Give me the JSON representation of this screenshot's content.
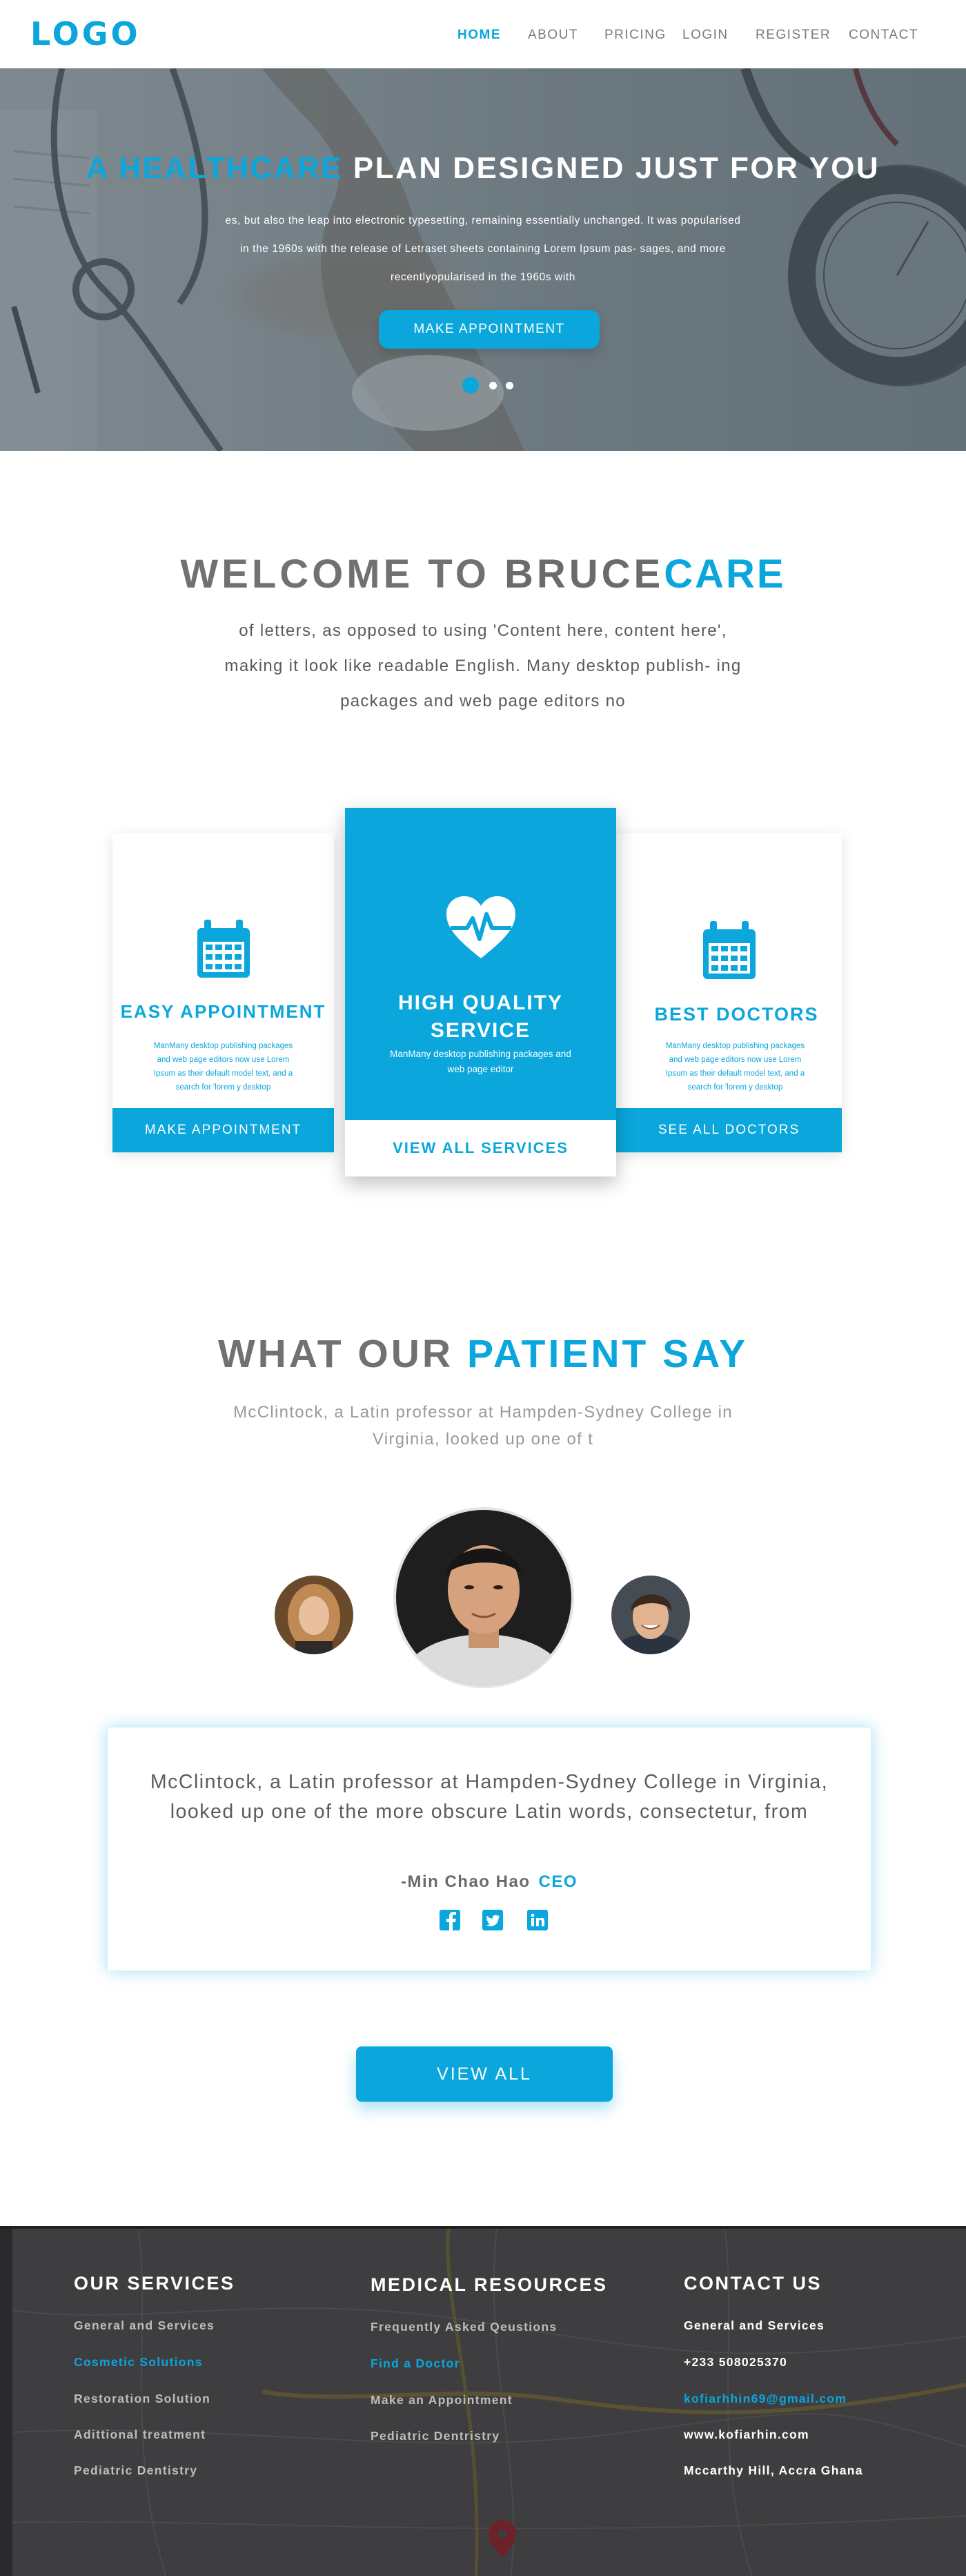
{
  "brand": {
    "logo": "LOGO",
    "accent": "#0aa6dc"
  },
  "nav": {
    "items": [
      {
        "label": "HOME",
        "active": true
      },
      {
        "label": "ABOUT",
        "active": false
      },
      {
        "label": "PRICING",
        "active": false
      },
      {
        "label": "LOGIN",
        "active": false
      },
      {
        "label": "REGISTER",
        "active": false
      },
      {
        "label": "CONTACT",
        "active": false
      }
    ]
  },
  "hero": {
    "title_highlight": "A HEALTHCARE",
    "title_rest": " PLAN DESIGNED JUST FOR YOU",
    "text": "es, but also the leap into electronic typesetting, remaining essentially unchanged. It was popularised in the 1960s with the release of Letraset sheets containing Lorem Ipsum pas- sages, and more recentlyopularised in the 1960s with",
    "button": "MAKE APPOINTMENT",
    "slides": 3,
    "active_slide": 1
  },
  "welcome": {
    "prefix": "WELCOME TO ",
    "brand_a": "BRUCE",
    "brand_b": "CARE",
    "text": "of letters, as opposed to using 'Content here, content here', making it look like readable English. Many desktop publish- ing packages and web page editors no"
  },
  "services": [
    {
      "icon": "calendar-icon",
      "title": "EASY APPOINTMENT",
      "text": "ManMany desktop publishing packages and web page editors now use Lorem Ipsum as their default model text, and a search for 'lorem y desktop",
      "button": "MAKE APPOINTMENT"
    },
    {
      "icon": "heart-pulse-icon",
      "title": "HIGH QUALITY SERVICE",
      "text": "ManMany desktop publishing packages and web page editor",
      "button": "VIEW ALL SERVICES"
    },
    {
      "icon": "calendar-icon",
      "title": "BEST DOCTORS",
      "text": "ManMany desktop publishing packages and web page editors now use Lorem Ipsum as their default model text, and a search for 'lorem y desktop",
      "button": "SEE ALL DOCTORS"
    }
  ],
  "testimonials": {
    "title_prefix": "WHAT OUR ",
    "title_highlight": "PATIENT SAY",
    "subtitle": "McClintock, a Latin professor at Hampden-Sydney College in Virginia, looked up one of t",
    "quote": "McClintock, a Latin professor at Hampden-Sydney College in Virginia, looked up one of the more obscure Latin words, consectetur, from",
    "author": "-Min Chao Hao",
    "role": "CEO",
    "socials": [
      "facebook-icon",
      "twitter-icon",
      "linkedin-icon"
    ],
    "button": "VIEW ALL"
  },
  "footer": {
    "services": {
      "title": "OUR SERVICES",
      "items": [
        "General and Services",
        "Cosmetic Solutions",
        "Restoration Solution",
        "Adittional treatment",
        "Pediatric Dentistry"
      ]
    },
    "resources": {
      "title": "MEDICAL RESOURCES",
      "items": [
        "Frequently Asked Qeustions",
        "Find a Doctor",
        "Make an Appointment",
        "Pediatric Dentristry"
      ]
    },
    "contact": {
      "title": "CONTACT US",
      "items": [
        "General and Services",
        "+233 508025370",
        "kofiarhhin69@gmail.com",
        "www.kofiarhin.com",
        "Mccarthy Hill, Accra Ghana"
      ]
    }
  }
}
